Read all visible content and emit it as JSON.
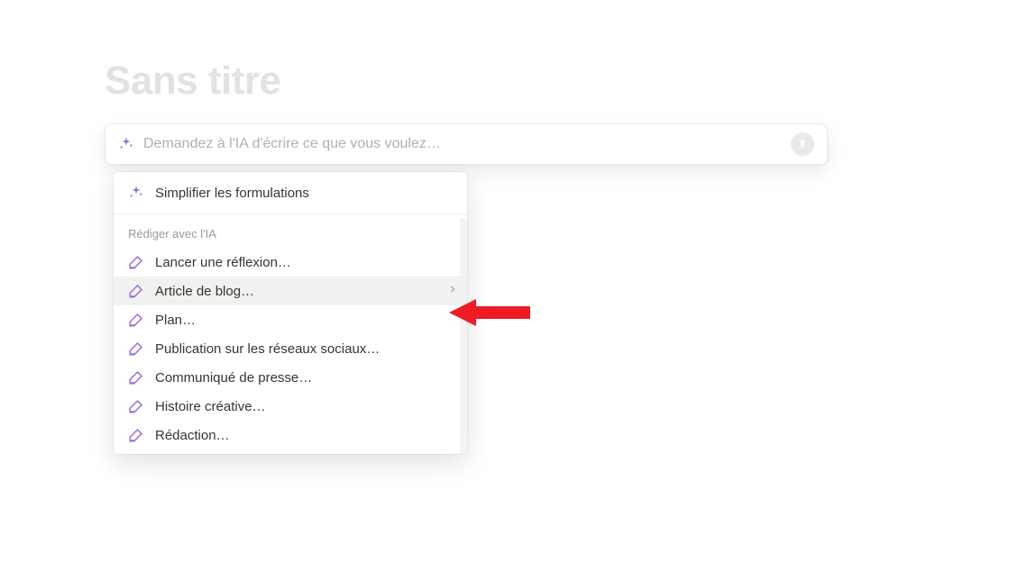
{
  "page": {
    "title": "Sans titre"
  },
  "ai_bar": {
    "placeholder": "Demandez à l'IA d'écrire ce que vous voulez…"
  },
  "dropdown": {
    "top_action": "Simplifier les formulations",
    "section_header": "Rédiger avec l'IA",
    "items": [
      {
        "label": "Lancer une réflexion…",
        "hovered": false
      },
      {
        "label": "Article de blog…",
        "hovered": true
      },
      {
        "label": "Plan…",
        "hovered": false
      },
      {
        "label": "Publication sur les réseaux sociaux…",
        "hovered": false
      },
      {
        "label": "Communiqué de presse…",
        "hovered": false
      },
      {
        "label": "Histoire créative…",
        "hovered": false
      },
      {
        "label": "Rédaction…",
        "hovered": false
      }
    ]
  },
  "colors": {
    "accent": "#9a6dd7",
    "arrow": "#ed1c24"
  }
}
